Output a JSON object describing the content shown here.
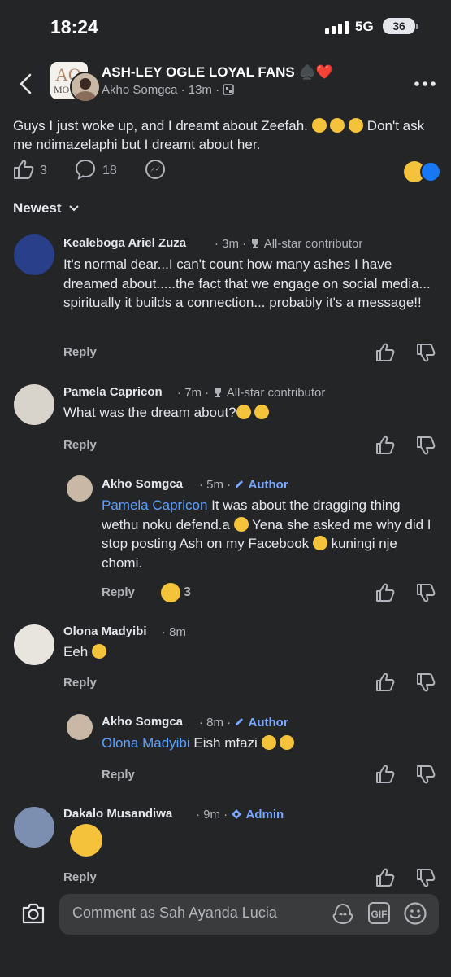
{
  "status_bar": {
    "time": "18:24",
    "network": "5G",
    "battery": "36"
  },
  "header": {
    "group_name": "ASH-LEY OGLE LOYAL FANS ♠️❤️",
    "logo_text_top": "AO",
    "logo_text_bottom": "MO",
    "author": "Akho Somgca",
    "time": "13m",
    "sep": "·"
  },
  "post": {
    "text_part1": "Guys I just woke up, and I dreamt about Zeefah. ",
    "text_part2": " Don't ask me ndimazelaphi but I dreamt about her.",
    "likes": "3",
    "comments": "18"
  },
  "sort": {
    "label": "Newest"
  },
  "comments": [
    {
      "name": "Kealeboga Ariel Zuza",
      "time": "· 3m ·",
      "badge": "All-star contributor",
      "text": "It's normal dear...I can't count how many ashes I have dreamed about.....the fact that we engage on social media... spiritually it builds a connection... probably it's a message!!",
      "reply": "Reply"
    },
    {
      "name": "Pamela Capricon",
      "time": "· 7m ·",
      "badge": "All-star contributor",
      "text": "What was the dream about?",
      "reply": "Reply"
    },
    {
      "name": "Akho Somgca",
      "time": "· 5m ·",
      "badge": "Author",
      "mention": "Pamela Capricon",
      "text": " It was about the dragging thing wethu noku defend.a ",
      "text2": " Yena she asked me why did I stop posting Ash on my Facebook ",
      "text3": " kuningi nje chomi.",
      "reply": "Reply",
      "reactions": "3"
    },
    {
      "name": "Olona Madyibi",
      "time": "· 8m",
      "text": "Eeh ",
      "reply": "Reply"
    },
    {
      "name": "Akho Somgca",
      "time": "· 8m ·",
      "badge": "Author",
      "mention": "Olona Madyibi",
      "text": " Eish mfazi ",
      "reply": "Reply"
    },
    {
      "name": "Dakalo Musandiwa",
      "time": "· 9m ·",
      "badge": "Admin",
      "reply": "Reply"
    }
  ],
  "composer": {
    "placeholder": "Comment as Sah Ayanda Lucia",
    "gif_label": "GIF"
  },
  "colors": {
    "background": "#242527",
    "text": "#e4e6eb",
    "muted": "#b0b3b8",
    "link": "#5aa0ff",
    "like_blue": "#1877f2"
  },
  "icons": [
    "back-arrow-icon",
    "more-icon",
    "like-icon",
    "comment-icon",
    "messenger-icon",
    "chevron-down-icon",
    "trophy-icon",
    "pencil-icon",
    "admin-icon",
    "thumbs-up-icon",
    "thumbs-down-icon",
    "camera-icon",
    "avatar-sticker-icon",
    "gif-icon",
    "smiley-icon"
  ]
}
